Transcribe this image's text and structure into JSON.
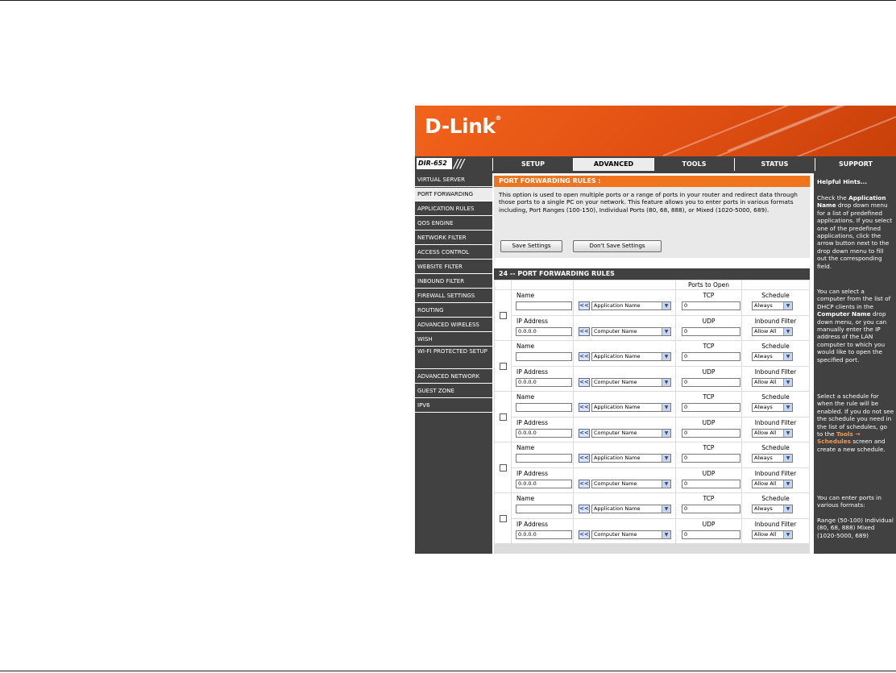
{
  "brand": {
    "logo": "D-Link",
    "model": "DIR-652",
    "slashes": "///"
  },
  "tabs": [
    "SETUP",
    "ADVANCED",
    "TOOLS",
    "STATUS",
    "SUPPORT"
  ],
  "active_tab": "ADVANCED",
  "nav": [
    "VIRTUAL SERVER",
    "PORT FORWARDING",
    "APPLICATION RULES",
    "QOS ENGINE",
    "NETWORK FILTER",
    "ACCESS CONTROL",
    "WEBSITE FILTER",
    "INBOUND FILTER",
    "FIREWALL SETTINGS",
    "ROUTING",
    "ADVANCED WIRELESS",
    "WISH",
    "WI-FI PROTECTED SETUP",
    "ADVANCED NETWORK",
    "GUEST ZONE",
    "IPV6"
  ],
  "active_nav": "PORT FORWARDING",
  "intro": {
    "title": "PORT FORWARDING RULES :",
    "description": "This option is used to open multiple ports or a range of ports in your router and redirect data through those ports to a single PC on your network. This feature allows you to enter ports in various formats including, Port Ranges (100-150), Individual Ports (80, 68, 888), or Mixed (1020-5000, 689).",
    "save_label": "Save Settings",
    "dont_save_label": "Don't Save Settings"
  },
  "rules": {
    "title": "24 -- PORT FORWARDING RULES",
    "ports_header": "Ports to Open",
    "labels": {
      "name": "Name",
      "ip": "IP Address",
      "tcp": "TCP",
      "udp": "UDP",
      "schedule": "Schedule",
      "inbound": "Inbound Filter",
      "add": "<<",
      "arrow": "▼"
    },
    "rows": [
      {
        "name": "",
        "ip": "0.0.0.0",
        "application": "Application Name",
        "computer": "Computer Name",
        "tcp": "0",
        "udp": "0",
        "schedule": "Always",
        "inbound": "Allow All"
      },
      {
        "name": "",
        "ip": "0.0.0.0",
        "application": "Application Name",
        "computer": "Computer Name",
        "tcp": "0",
        "udp": "0",
        "schedule": "Always",
        "inbound": "Allow All"
      },
      {
        "name": "",
        "ip": "0.0.0.0",
        "application": "Application Name",
        "computer": "Computer Name",
        "tcp": "0",
        "udp": "0",
        "schedule": "Always",
        "inbound": "Allow All"
      },
      {
        "name": "",
        "ip": "0.0.0.0",
        "application": "Application Name",
        "computer": "Computer Name",
        "tcp": "0",
        "udp": "0",
        "schedule": "Always",
        "inbound": "Allow All"
      },
      {
        "name": "",
        "ip": "0.0.0.0",
        "application": "Application Name",
        "computer": "Computer Name",
        "tcp": "0",
        "udp": "0",
        "schedule": "Always",
        "inbound": "Allow All"
      }
    ]
  },
  "hints": {
    "title": "Helpful Hints...",
    "p1_a": "Check the ",
    "p1_b": "Application Name",
    "p1_c": " drop down menu for a list of predefined applications. If you select one of the predefined applications, click the arrow button next to the drop down menu to fill out the corresponding field.",
    "p2_a": "You can select a computer from the list of DHCP clients in the ",
    "p2_b": "Computer Name",
    "p2_c": " drop down menu, or you can manually enter the IP address of the LAN computer to which you would like to open the specified port.",
    "p3_a": "Select a schedule for when the rule will be enabled. If you do not see the schedule you need in the list of schedules, go to the ",
    "p3_b": "Tools → Schedules",
    "p3_c": " screen and create a new schedule.",
    "p4": "You can enter ports in various formats:",
    "p5": "Range (50-100) Individual (80, 68, 888) Mixed (1020-5000, 689)"
  },
  "colors": {
    "orange": "#f0731e",
    "dark": "#414141",
    "panel": "#e9e9e9",
    "hint_link": "#f39a52"
  }
}
